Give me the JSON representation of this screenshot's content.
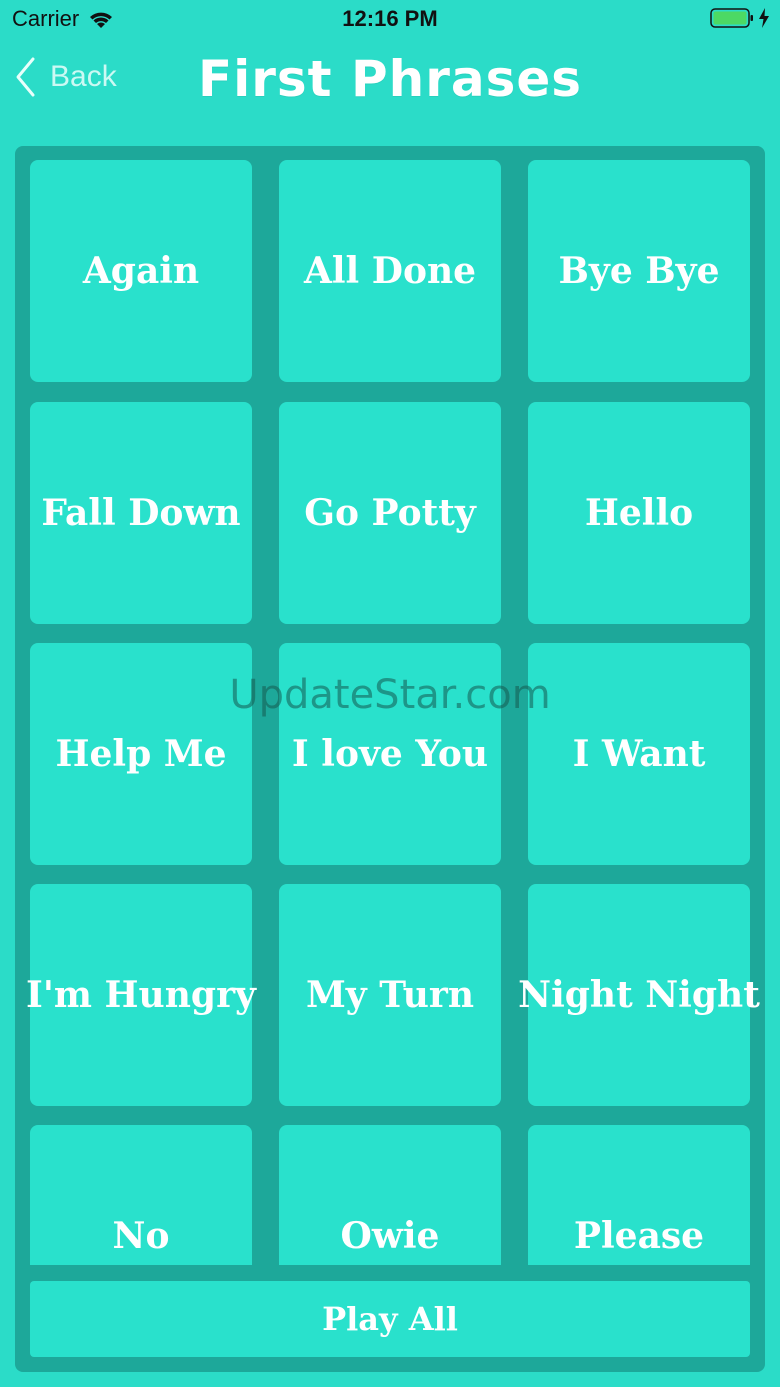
{
  "status_bar": {
    "carrier": "Carrier",
    "time": "12:16 PM",
    "battery_color": "#4cd964"
  },
  "nav": {
    "back_label": "Back",
    "title": "First Phrases"
  },
  "tiles": [
    {
      "label": "Again"
    },
    {
      "label": "All Done"
    },
    {
      "label": "Bye Bye"
    },
    {
      "label": "Fall Down"
    },
    {
      "label": "Go Potty"
    },
    {
      "label": "Hello"
    },
    {
      "label": "Help Me"
    },
    {
      "label": "I love You"
    },
    {
      "label": "I Want"
    },
    {
      "label": "I'm Hungry"
    },
    {
      "label": "My Turn"
    },
    {
      "label": "Night Night"
    },
    {
      "label": "No"
    },
    {
      "label": "Owie"
    },
    {
      "label": "Please"
    }
  ],
  "play_all_label": "Play All",
  "watermark": "UpdateStar.com",
  "colors": {
    "background": "#2bdcc8",
    "panel": "#1da89a",
    "tile": "#29e1cc",
    "text": "#ffffff"
  }
}
